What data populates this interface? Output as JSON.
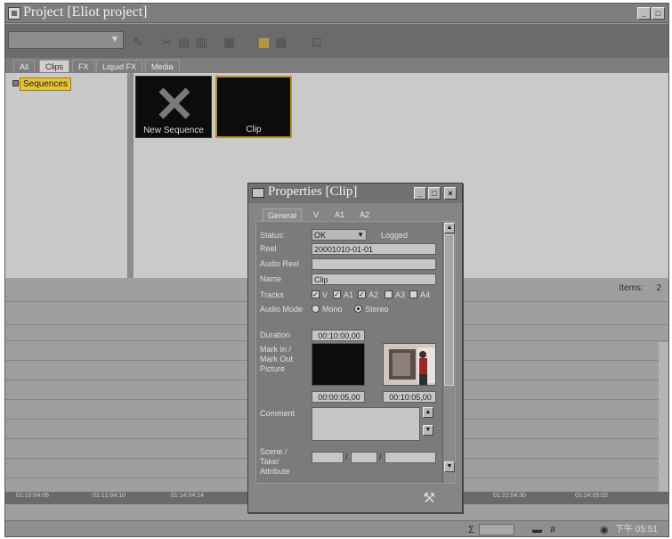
{
  "window": {
    "title": "Project [Eliot project]",
    "buttons": {
      "minimize": "_",
      "maximize": "□"
    }
  },
  "toolbar": {
    "dropdown_value": "",
    "icons": [
      "pencil-icon",
      "cut-icon",
      "copy-icon",
      "paste-icon",
      "list-icon",
      "grid-view-icon",
      "table-icon",
      "export-icon"
    ]
  },
  "tabs": [
    {
      "label": "All"
    },
    {
      "label": "Clips"
    },
    {
      "label": "FX"
    },
    {
      "label": "Liquid FX"
    },
    {
      "label": "Media"
    }
  ],
  "tree": {
    "sequences_label": "Sequences"
  },
  "bins": [
    {
      "label": "New Sequence"
    },
    {
      "label": "Clip"
    }
  ],
  "lower": {
    "items_label": "Items:",
    "items_count": "2"
  },
  "ruler": [
    "01:10:04:06",
    "01:12:04:10",
    "01:14:04:14",
    "01:22:04:30",
    "01:24:05:02"
  ],
  "status": {
    "sigma": "Σ",
    "hash": "#",
    "time": "下午 05:51"
  },
  "dialog": {
    "title": "Properties [Clip]",
    "buttons": {
      "minimize": "_",
      "maximize": "□",
      "close": "×"
    },
    "tabs": [
      "General",
      "V",
      "A1",
      "A2"
    ],
    "status_label": "Status:",
    "status_value": "OK",
    "logged_label": "Logged",
    "reel_label": "Reel",
    "reel_value": "20001010-01-01",
    "audio_reel_label": "Audio Reel",
    "audio_reel_value": "",
    "name_label": "Name",
    "name_value": "Clip",
    "tracks_label": "Tracks",
    "tracks": [
      {
        "label": "V",
        "checked": true
      },
      {
        "label": "A1",
        "checked": true
      },
      {
        "label": "A2",
        "checked": true
      },
      {
        "label": "A3",
        "checked": false
      },
      {
        "label": "A4",
        "checked": false
      }
    ],
    "audio_mode_label": "Audio Mode",
    "audio_modes": [
      {
        "label": "Mono",
        "selected": false
      },
      {
        "label": "Stereo",
        "selected": true
      }
    ],
    "duration_label": "Duration",
    "duration_value": "00:10:00,00",
    "mark_label_1": "Mark In /",
    "mark_label_2": "Mark Out",
    "mark_label_3": "Picture",
    "mark_in_tc": "00:00:05,00",
    "mark_out_tc": "00:10:05,00",
    "comment_label": "Comment",
    "scene_label_1": "Scene /",
    "scene_label_2": "Take/",
    "scene_label_3": "Attribute",
    "separator": "/"
  }
}
